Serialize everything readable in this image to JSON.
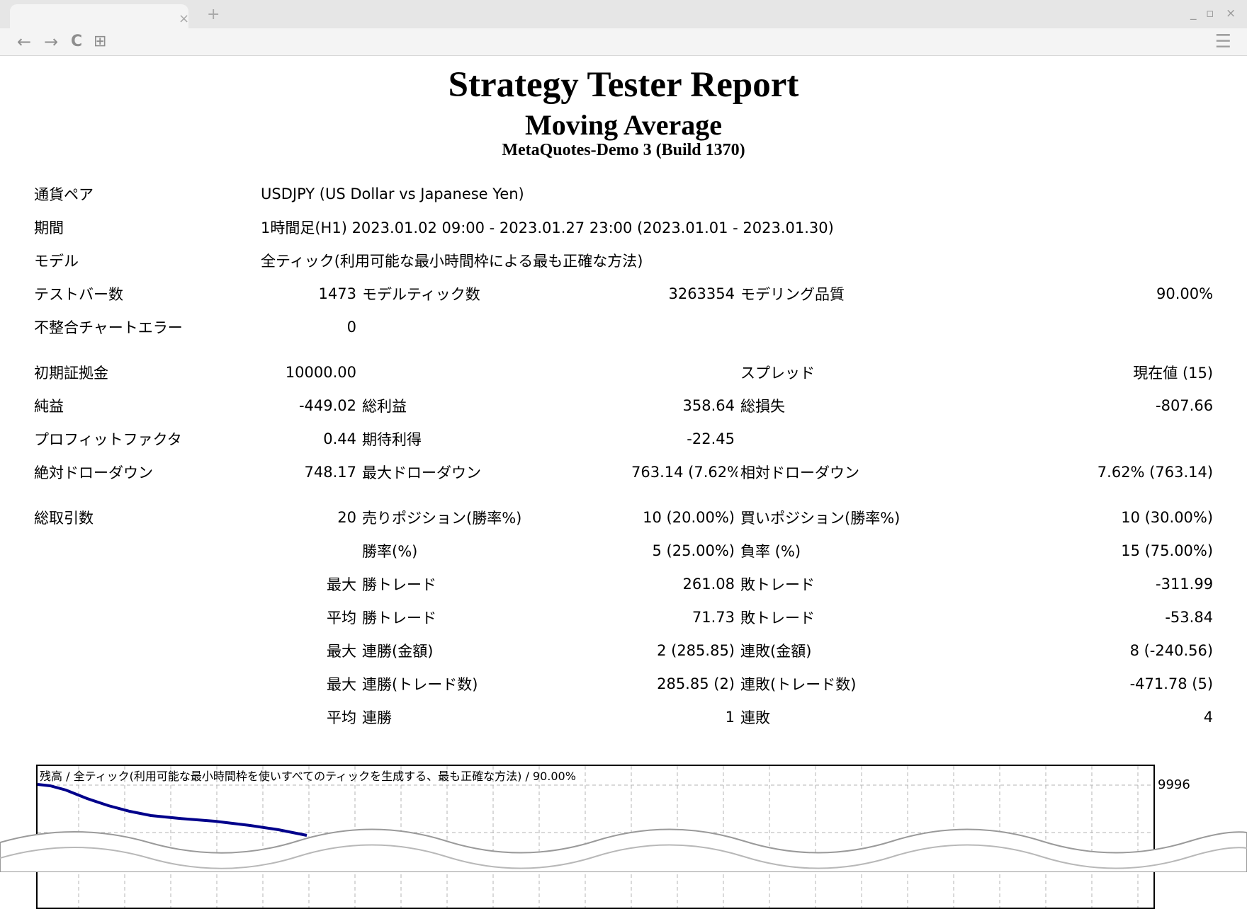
{
  "browser": {
    "tab_close": "×",
    "new_tab": "+",
    "window_controls": [
      "_",
      "▫",
      "×"
    ],
    "nav": {
      "back": "←",
      "forward": "→",
      "reload": "C",
      "apps": "⊞"
    },
    "menu": "☰"
  },
  "report": {
    "title": "Strategy Tester Report",
    "subtitle": "Moving Average",
    "server": "MetaQuotes-Demo 3 (Build 1370)",
    "summary": {
      "symbol_label": "通貨ペア",
      "symbol_value": "USDJPY (US Dollar vs Japanese Yen)",
      "period_label": "期間",
      "period_value": "1時間足(H1) 2023.01.02 09:00 - 2023.01.27 23:00 (2023.01.01 - 2023.01.30)",
      "model_label": "モデル",
      "model_value": "全ティック(利用可能な最小時間枠による最も正確な方法)",
      "bars_label": "テストバー数",
      "bars_value": "1473",
      "ticks_label": "モデルティック数",
      "ticks_value": "3263354",
      "quality_label": "モデリング品質",
      "quality_value": "90.00%",
      "mismatch_label": "不整合チャートエラー",
      "mismatch_value": "0"
    },
    "results": {
      "deposit_label": "初期証拠金",
      "deposit_value": "10000.00",
      "spread_label": "スプレッド",
      "spread_value": "現在値 (15)",
      "net_label": "純益",
      "net_value": "-449.02",
      "gross_profit_label": "総利益",
      "gross_profit_value": "358.64",
      "gross_loss_label": "総損失",
      "gross_loss_value": "-807.66",
      "pf_label": "プロフィットファクタ",
      "pf_value": "0.44",
      "expected_label": "期待利得",
      "expected_value": "-22.45",
      "abs_dd_label": "絶対ドローダウン",
      "abs_dd_value": "748.17",
      "max_dd_label": "最大ドローダウン",
      "max_dd_value": "763.14 (7.62%)",
      "rel_dd_label": "相対ドローダウン",
      "rel_dd_value": "7.62% (763.14)"
    },
    "trades": {
      "total_label": "総取引数",
      "total_value": "20",
      "short_label": "売りポジション(勝率%)",
      "short_value": "10 (20.00%)",
      "long_label": "買いポジション(勝率%)",
      "long_value": "10 (30.00%)",
      "win_rate_label": "勝率(%)",
      "win_rate_value": "5 (25.00%)",
      "loss_rate_label": "負率 (%)",
      "loss_rate_value": "15 (75.00%)",
      "max_prefix": "最大",
      "avg_prefix": "平均",
      "largest_win_label": "勝トレード",
      "largest_win_value": "261.08",
      "largest_loss_label": "敗トレード",
      "largest_loss_value": "-311.99",
      "avg_win_label": "勝トレード",
      "avg_win_value": "71.73",
      "avg_loss_label": "敗トレード",
      "avg_loss_value": "-53.84",
      "max_cons_wins_amt_label": "連勝(金額)",
      "max_cons_wins_amt_value": "2 (285.85)",
      "max_cons_losses_amt_label": "連敗(金額)",
      "max_cons_losses_amt_value": "8 (-240.56)",
      "max_cons_profit_label": "連勝(トレード数)",
      "max_cons_profit_value": "285.85 (2)",
      "max_cons_loss_label": "連敗(トレード数)",
      "max_cons_loss_value": "-471.78 (5)",
      "avg_cons_wins_label": "連勝",
      "avg_cons_wins_value": "1",
      "avg_cons_losses_label": "連敗",
      "avg_cons_losses_value": "4"
    },
    "chart": {
      "label": "残高 / 全ティック(利用可能な最小時間枠を使いすべてのティックを生成する、最も正確な方法) / 90.00%",
      "y_tick": "9996",
      "line_color": "#00008b",
      "grid_color": "#b4b4b4"
    }
  }
}
